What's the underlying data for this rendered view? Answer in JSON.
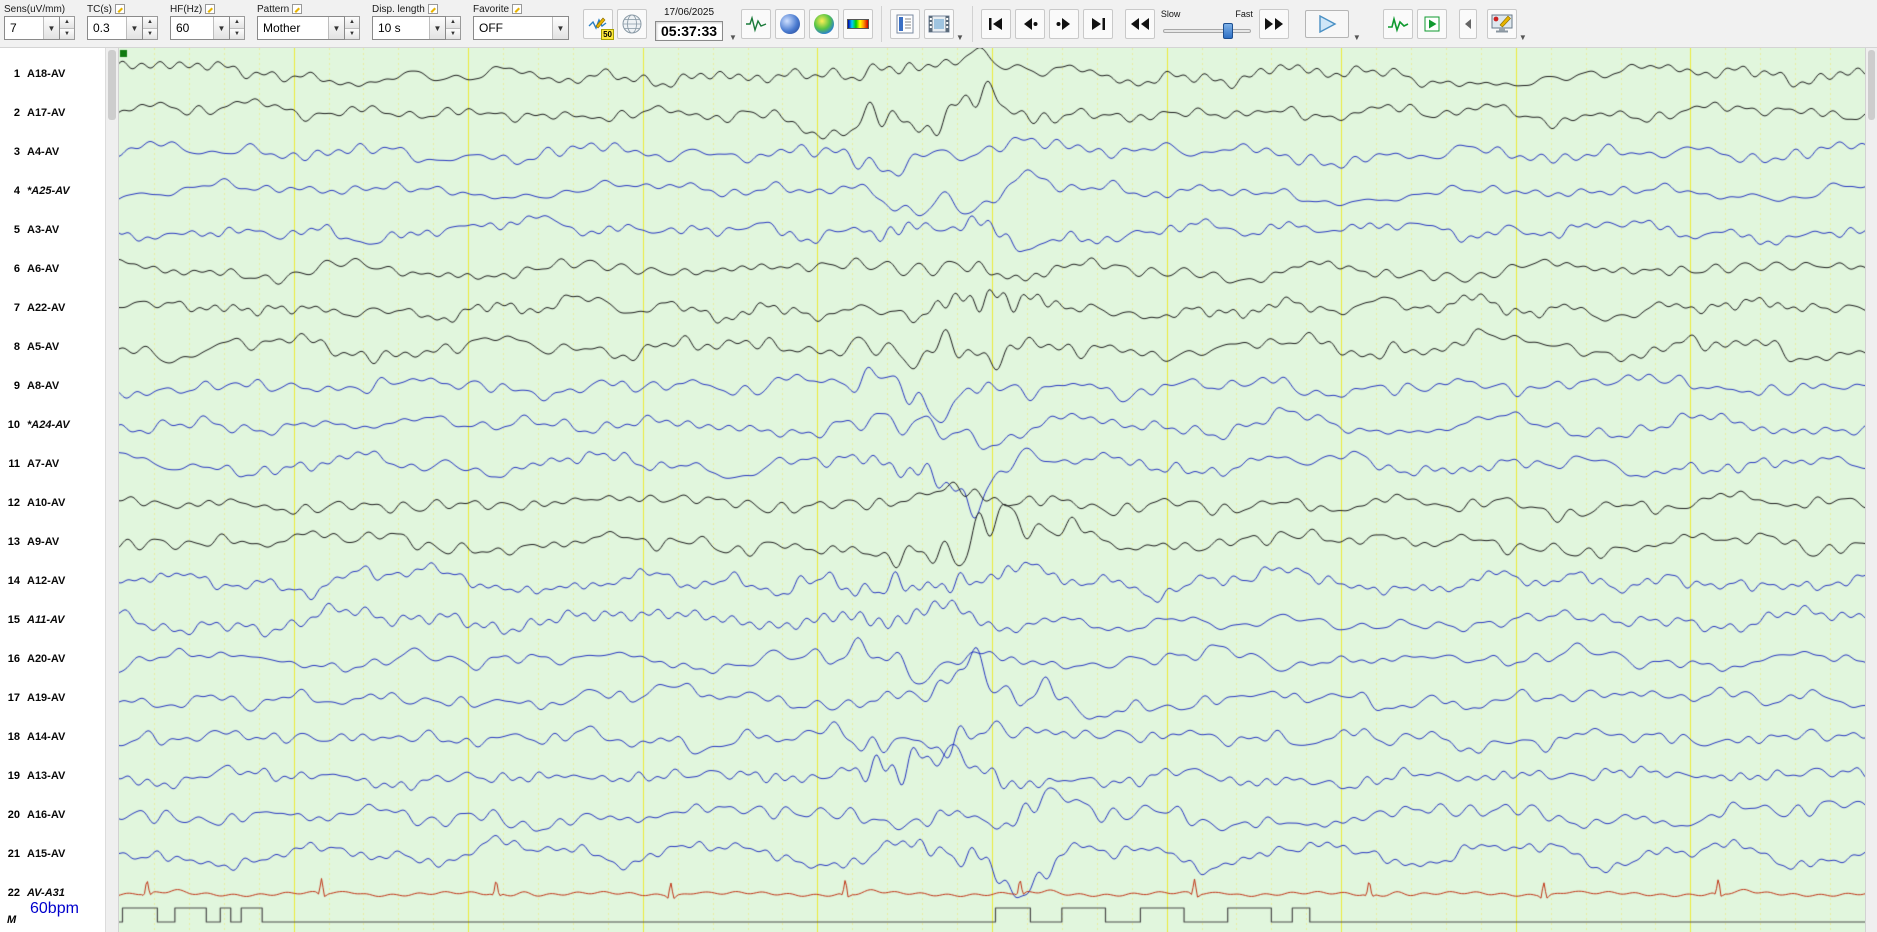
{
  "toolbar": {
    "sens": {
      "label": "Sens(uV/mm)",
      "value": "7"
    },
    "tc": {
      "label": "TC(s)",
      "value": "0.3"
    },
    "hf": {
      "label": "HF(Hz)",
      "value": "60"
    },
    "pattern": {
      "label": "Pattern",
      "value": "Mother"
    },
    "disp_length": {
      "label": "Disp. length",
      "value": "10 s"
    },
    "favorite": {
      "label": "Favorite",
      "value": "OFF"
    },
    "notch_badge": "50",
    "date": "17/06/2025",
    "time": "05:37:33",
    "slider": {
      "slow_label": "Slow",
      "fast_label": "Fast"
    }
  },
  "channels": [
    {
      "num": 1,
      "label": "A18-AV",
      "color": "black",
      "italic": false
    },
    {
      "num": 2,
      "label": "A17-AV",
      "color": "black",
      "italic": false
    },
    {
      "num": 3,
      "label": "A4-AV",
      "color": "blue",
      "italic": false
    },
    {
      "num": 4,
      "label": "*A25-AV",
      "color": "blue",
      "italic": true
    },
    {
      "num": 5,
      "label": "A3-AV",
      "color": "blue",
      "italic": false
    },
    {
      "num": 6,
      "label": "A6-AV",
      "color": "black",
      "italic": false
    },
    {
      "num": 7,
      "label": "A22-AV",
      "color": "black",
      "italic": false
    },
    {
      "num": 8,
      "label": "A5-AV",
      "color": "black",
      "italic": false
    },
    {
      "num": 9,
      "label": "A8-AV",
      "color": "blue",
      "italic": false
    },
    {
      "num": 10,
      "label": "*A24-AV",
      "color": "blue",
      "italic": true
    },
    {
      "num": 11,
      "label": "A7-AV",
      "color": "blue",
      "italic": false
    },
    {
      "num": 12,
      "label": "A10-AV",
      "color": "black",
      "italic": false
    },
    {
      "num": 13,
      "label": "A9-AV",
      "color": "black",
      "italic": false
    },
    {
      "num": 14,
      "label": "A12-AV",
      "color": "blue",
      "italic": false
    },
    {
      "num": 15,
      "label": "A11-AV",
      "color": "blue",
      "italic": true
    },
    {
      "num": 16,
      "label": "A20-AV",
      "color": "blue",
      "italic": false
    },
    {
      "num": 17,
      "label": "A19-AV",
      "color": "blue",
      "italic": false
    },
    {
      "num": 18,
      "label": "A14-AV",
      "color": "blue",
      "italic": false
    },
    {
      "num": 19,
      "label": "A13-AV",
      "color": "blue",
      "italic": false
    },
    {
      "num": 20,
      "label": "A16-AV",
      "color": "blue",
      "italic": false
    },
    {
      "num": 21,
      "label": "A15-AV",
      "color": "blue",
      "italic": false
    },
    {
      "num": 22,
      "label": "AV-A31",
      "color": "red",
      "italic": true
    }
  ],
  "ecg": {
    "bpm_label": "60bpm",
    "beats_per_screen": 10
  },
  "marker": {
    "label": "M",
    "pulses": [
      [
        0.002,
        0.022
      ],
      [
        0.032,
        0.05
      ],
      [
        0.058,
        0.064
      ],
      [
        0.07,
        0.082
      ],
      [
        0.502,
        0.522
      ],
      [
        0.54,
        0.565
      ],
      [
        0.585,
        0.61
      ],
      [
        0.635,
        0.66
      ],
      [
        0.672,
        0.682
      ]
    ]
  },
  "display": {
    "bg": "#e1f6dd",
    "grid_major": "#ecec3c",
    "grid_minor": "#e9eda0",
    "trace_black": "#1d1d1d",
    "trace_blue": "#2636c0",
    "trace_red": "#c03214",
    "marker_color": "#4a4a4a",
    "event_marker": "#117a11",
    "seconds": 10,
    "minor_per_major": 5
  }
}
